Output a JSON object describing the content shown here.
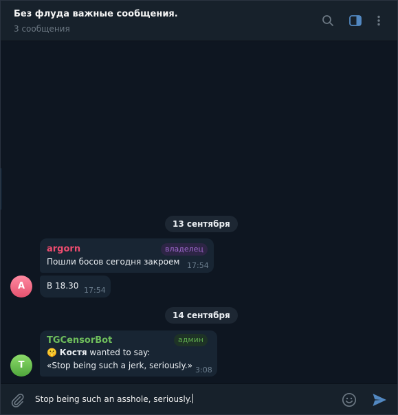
{
  "header": {
    "title": "Без флуда важные сообщения.",
    "subtitle": "3 сообщения",
    "icons": [
      "search-icon",
      "sidebar-toggle-icon",
      "more-vertical-icon"
    ]
  },
  "dates": [
    "13 сентября",
    "14 сентября"
  ],
  "messages": [
    {
      "author": "argorn",
      "role": "владелец",
      "text": "Пошли босов сегодня закроем",
      "time": "17:54",
      "avatar_letter": "A"
    },
    {
      "text": "В 18.30",
      "time": "17:54"
    },
    {
      "author": "TGCensorBot",
      "role": "админ",
      "emoji": "🤫",
      "bold_part": "Костя",
      "line1_rest": " wanted to say:",
      "line2": "«Stop being such a jerk, seriously.»",
      "time": "3:08",
      "avatar_letter": "T"
    }
  ],
  "composer": {
    "value": "Stop being such an asshole, seriously.",
    "icons": [
      "attach-icon",
      "emoji-icon",
      "send-icon"
    ]
  },
  "colors": {
    "accent": "#5288c1",
    "argorn_name": "#ee4c6f",
    "bot_name": "#6fbe5c",
    "owner_badge": "#a36ad3",
    "admin_badge": "#5ea84c"
  }
}
